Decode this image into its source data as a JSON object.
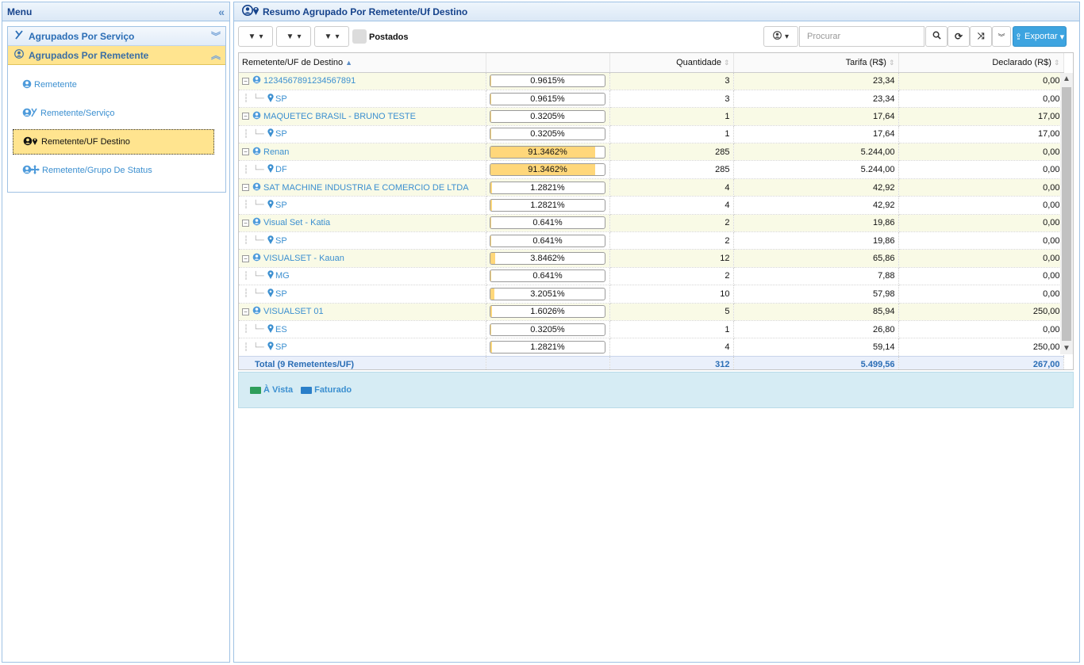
{
  "menu": {
    "title": "Menu",
    "collapse_icon": "«",
    "sections": [
      {
        "label": "Agrupados Por Serviço",
        "icon": "service-icon",
        "chevron": "»"
      },
      {
        "label": "Agrupados Por Remetente",
        "icon": "user-icon",
        "chevron": "«"
      }
    ],
    "items": [
      {
        "label": "Remetente",
        "icon": "user-icon"
      },
      {
        "label": "Remetente/Serviço",
        "icon": "user-service-icon"
      },
      {
        "label": "Remetente/UF Destino",
        "icon": "user-pin-icon"
      },
      {
        "label": "Remetente/Grupo De Status",
        "icon": "user-status-icon"
      }
    ]
  },
  "main": {
    "title": "Resumo Agrupado Por Remetente/Uf Destino",
    "postados_label": "Postados",
    "search_placeholder": "Procurar",
    "export_label": "Exportar"
  },
  "grid": {
    "columns": [
      "Remetente/UF de Destino",
      "",
      "Quantidade",
      "Tarifa (R$)",
      "Declarado (R$)"
    ],
    "rows": [
      {
        "type": "group",
        "name": "1234567891234567891",
        "pct": "0.9615%",
        "pct_value": 0.9615,
        "qty": "3",
        "tarifa": "23,34",
        "declarado": "0,00"
      },
      {
        "type": "sub",
        "name": "SP",
        "pct": "0.9615%",
        "pct_value": 0.9615,
        "qty": "3",
        "tarifa": "23,34",
        "declarado": "0,00"
      },
      {
        "type": "group",
        "name": "MAQUETEC BRASIL - BRUNO TESTE",
        "pct": "0.3205%",
        "pct_value": 0.3205,
        "qty": "1",
        "tarifa": "17,64",
        "declarado": "17,00"
      },
      {
        "type": "sub",
        "name": "SP",
        "pct": "0.3205%",
        "pct_value": 0.3205,
        "qty": "1",
        "tarifa": "17,64",
        "declarado": "17,00"
      },
      {
        "type": "group",
        "name": "Renan",
        "pct": "91.3462%",
        "pct_value": 91.3462,
        "qty": "285",
        "tarifa": "5.244,00",
        "declarado": "0,00"
      },
      {
        "type": "sub",
        "name": "DF",
        "pct": "91.3462%",
        "pct_value": 91.3462,
        "qty": "285",
        "tarifa": "5.244,00",
        "declarado": "0,00"
      },
      {
        "type": "group",
        "name": "SAT MACHINE INDUSTRIA E COMERCIO DE LTDA",
        "pct": "1.2821%",
        "pct_value": 1.2821,
        "qty": "4",
        "tarifa": "42,92",
        "declarado": "0,00"
      },
      {
        "type": "sub",
        "name": "SP",
        "pct": "1.2821%",
        "pct_value": 1.2821,
        "qty": "4",
        "tarifa": "42,92",
        "declarado": "0,00"
      },
      {
        "type": "group",
        "name": "Visual Set - Katia",
        "pct": "0.641%",
        "pct_value": 0.641,
        "qty": "2",
        "tarifa": "19,86",
        "declarado": "0,00"
      },
      {
        "type": "sub",
        "name": "SP",
        "pct": "0.641%",
        "pct_value": 0.641,
        "qty": "2",
        "tarifa": "19,86",
        "declarado": "0,00"
      },
      {
        "type": "group",
        "name": "VISUALSET - Kauan",
        "pct": "3.8462%",
        "pct_value": 3.8462,
        "qty": "12",
        "tarifa": "65,86",
        "declarado": "0,00"
      },
      {
        "type": "sub",
        "name": "MG",
        "pct": "0.641%",
        "pct_value": 0.641,
        "qty": "2",
        "tarifa": "7,88",
        "declarado": "0,00"
      },
      {
        "type": "sub",
        "name": "SP",
        "pct": "3.2051%",
        "pct_value": 3.2051,
        "qty": "10",
        "tarifa": "57,98",
        "declarado": "0,00"
      },
      {
        "type": "group",
        "name": "VISUALSET 01",
        "pct": "1.6026%",
        "pct_value": 1.6026,
        "qty": "5",
        "tarifa": "85,94",
        "declarado": "250,00"
      },
      {
        "type": "sub",
        "name": "ES",
        "pct": "0.3205%",
        "pct_value": 0.3205,
        "qty": "1",
        "tarifa": "26,80",
        "declarado": "0,00"
      },
      {
        "type": "sub",
        "name": "SP",
        "pct": "1.2821%",
        "pct_value": 1.2821,
        "qty": "4",
        "tarifa": "59,14",
        "declarado": "250,00"
      }
    ],
    "total": {
      "label": "Total (9 Remetentes/UF)",
      "qty": "312",
      "tarifa": "5.499,56",
      "declarado": "267,00"
    }
  },
  "legend": [
    {
      "label": "À Vista",
      "color": "#2e9e5b",
      "icon": "cash-icon"
    },
    {
      "label": "Faturado",
      "color": "#2a7fc9",
      "icon": "card-icon"
    }
  ]
}
